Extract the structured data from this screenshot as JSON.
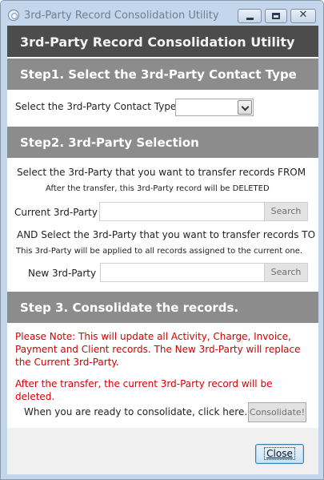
{
  "window": {
    "title": "3rd-Party Record Consolidation Utility",
    "close_glyph": "✕"
  },
  "header": {
    "title": "3rd-Party Record Consolidation Utility"
  },
  "step1": {
    "heading": "Step1. Select the 3rd-Party Contact Type",
    "field_label": "Select the 3rd-Party Contact Type",
    "selected_value": ""
  },
  "step2": {
    "heading": "Step2. 3rd-Party Selection",
    "from_instruction": "Select the 3rd-Party that you want to transfer records FROM",
    "from_note": "After the transfer, this 3rd-Party record will be DELETED",
    "current_label": "Current 3rd-Party",
    "current_value": "",
    "to_instruction": "AND Select the 3rd-Party that you want to transfer records TO",
    "to_note": "This 3rd-Party will be applied to all records assigned to the current one.",
    "new_label": "New 3rd-Party",
    "new_value": "",
    "search_label": "Search"
  },
  "step3": {
    "heading": "Step 3. Consolidate the records.",
    "warning": "Please Note: This will update all Activity, Charge, Invoice, Payment and Client records.  The New 3rd-Party will replace the Current 3rd-Party.",
    "deletion_note": "After the transfer, the current 3rd-Party record will be deleted.",
    "ready_text": "When you are ready to consolidate, click here.",
    "consolidate_label": "Consolidate!"
  },
  "footer": {
    "close_label": "Close"
  },
  "colors": {
    "header_dark": "#4c4c4c",
    "step_header": "#8c8c8c",
    "warning_text": "#d40000"
  }
}
